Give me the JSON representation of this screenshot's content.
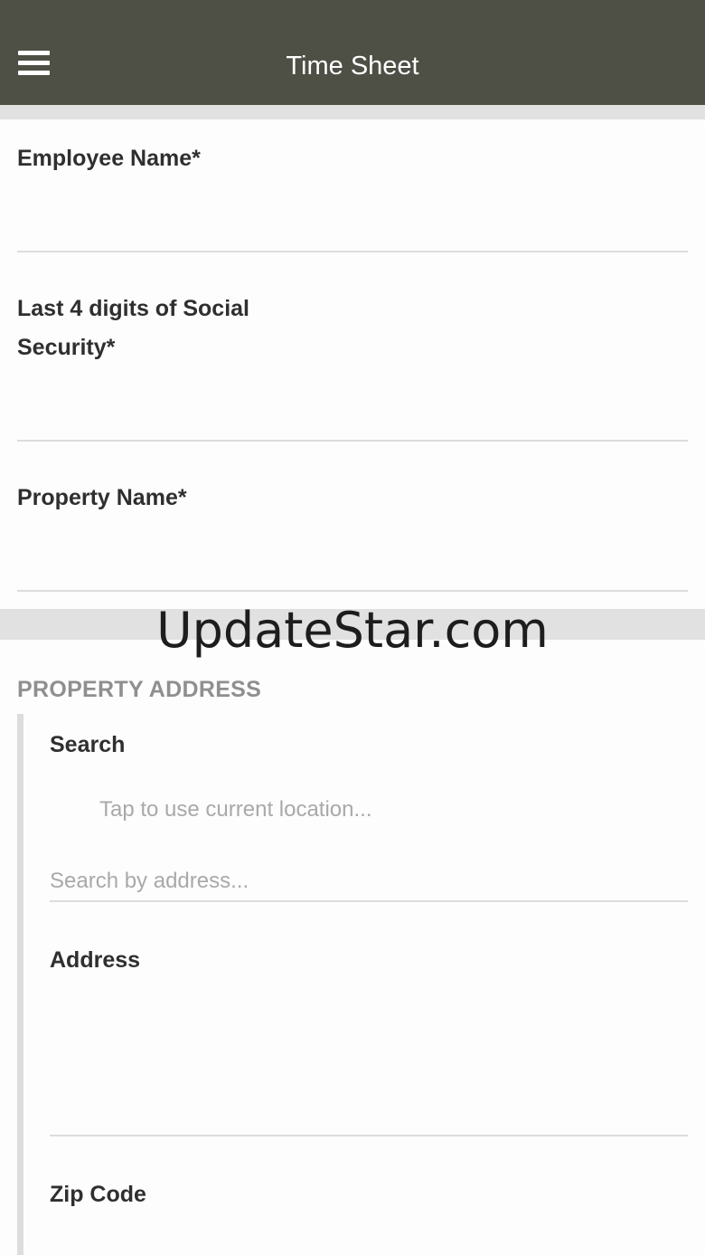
{
  "header": {
    "title": "Time Sheet",
    "menu_icon": "hamburger-menu-icon",
    "background": "#4e4f45"
  },
  "form": {
    "employee_name": {
      "label": "Employee Name*",
      "value": ""
    },
    "ssn_last4": {
      "label_line1": "Last 4 digits of Social",
      "label_line2": "Security*",
      "value": ""
    },
    "property_name": {
      "label": "Property Name*",
      "value": ""
    }
  },
  "watermark": "UpdateStar.com",
  "property_address": {
    "heading": "PROPERTY ADDRESS",
    "search": {
      "label": "Search",
      "current_location": "Tap to use current location...",
      "placeholder": "Search by address..."
    },
    "address": {
      "label": "Address",
      "value": ""
    },
    "zip_code": {
      "label": "Zip Code"
    }
  }
}
